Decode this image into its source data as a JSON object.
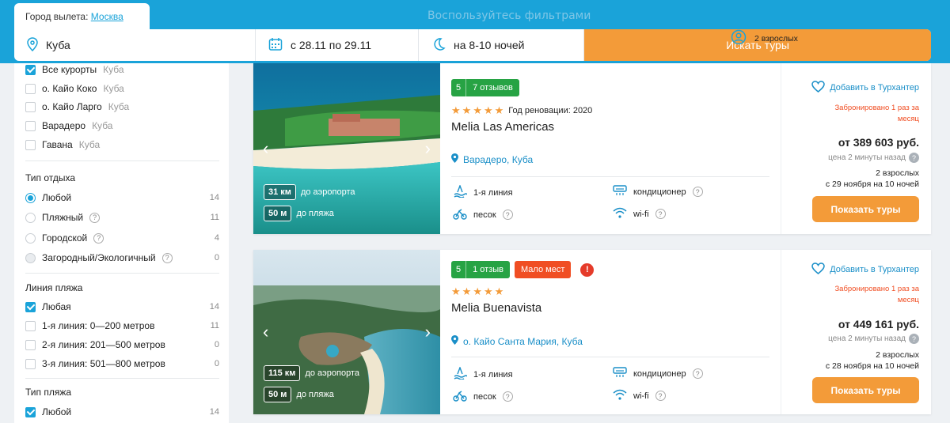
{
  "header": {
    "ghost_text": "Воспользуйтесь фильтрами",
    "departure_label": "Город вылета:",
    "departure_city": "Москва",
    "destination": "Куба",
    "dates": "с 28.11 по 29.11",
    "nights": "на 8-10 ночей",
    "travelers": "2 взрослых",
    "search_button": "Искать туры"
  },
  "sidebar": {
    "resorts": [
      {
        "name": "Все курорты",
        "country": "Куба",
        "checked": true
      },
      {
        "name": "о. Кайо Коко",
        "country": "Куба",
        "checked": false
      },
      {
        "name": "о. Кайо Ларго",
        "country": "Куба",
        "checked": false
      },
      {
        "name": "Варадеро",
        "country": "Куба",
        "checked": false
      },
      {
        "name": "Гавана",
        "country": "Куба",
        "checked": false
      }
    ],
    "rest_type": {
      "title": "Тип отдыха",
      "options": [
        {
          "label": "Любой",
          "count": "14"
        },
        {
          "label": "Пляжный",
          "count": "11"
        },
        {
          "label": "Городской",
          "count": "4"
        },
        {
          "label": "Загородный/Экологичный",
          "count": "0"
        }
      ]
    },
    "beach_line": {
      "title": "Линия пляжа",
      "options": [
        {
          "label": "Любая",
          "count": "14"
        },
        {
          "label": "1-я линия: 0—200 метров",
          "count": "11"
        },
        {
          "label": "2-я линия: 201—500 метров",
          "count": "0"
        },
        {
          "label": "3-я линия: 501—800 метров",
          "count": "0"
        }
      ]
    },
    "beach_type": {
      "title": "Тип пляжа",
      "options": [
        {
          "label": "Любой",
          "count": "14"
        }
      ]
    }
  },
  "hotels": [
    {
      "rating": "5",
      "reviews": "7 отзывов",
      "renovation": "Год реновации: 2020",
      "name": "Melia Las Americas",
      "location": "Варадеро, Куба",
      "airport_km": "31 км",
      "airport_label": "до аэропорта",
      "beach_m": "50 м",
      "beach_label": "до пляжа",
      "features": [
        "1-я линия",
        "песок",
        "кондиционер",
        "wi-fi"
      ],
      "favorite": "Добавить в Турхантер",
      "booked": "Забронировано 1 раз за месяц",
      "price": "от 389 603 руб.",
      "price_time": "цена 2 минуты назад",
      "pax": "2 взрослых",
      "period": "с 29 ноября на 10 ночей",
      "button": "Показать туры"
    },
    {
      "rating": "5",
      "reviews": "1 отзыв",
      "few_places": "Мало мест",
      "name": "Melia Buenavista",
      "location": "о. Кайо Санта Мария, Куба",
      "airport_km": "115 км",
      "airport_label": "до аэропорта",
      "beach_m": "50 м",
      "beach_label": "до пляжа",
      "features": [
        "1-я линия",
        "песок",
        "кондиционер",
        "wi-fi"
      ],
      "favorite": "Добавить в Турхантер",
      "booked": "Забронировано 1 раз за месяц",
      "price": "от 449 161 руб.",
      "price_time": "цена 2 минуты назад",
      "pax": "2 взрослых",
      "period": "с 28 ноября на 10 ночей",
      "button": "Показать туры"
    }
  ],
  "colors": {
    "accent": "#1aa3d9",
    "orange": "#f39b39",
    "green": "#27a344",
    "red": "#f04e23"
  }
}
